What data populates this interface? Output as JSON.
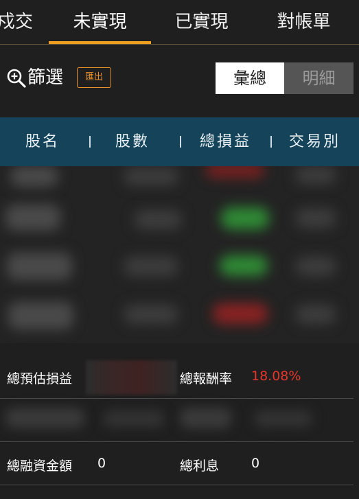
{
  "tabs": [
    {
      "label": "成交",
      "visible_text": "戍交"
    },
    {
      "label": "未實現"
    },
    {
      "label": "已實現"
    },
    {
      "label": "對帳單"
    }
  ],
  "active_tab": "未實現",
  "filter": {
    "label": "篩選",
    "export_label": "匯出",
    "view_toggle": {
      "summary": "彙總",
      "detail": "明細",
      "selected": "彙總"
    }
  },
  "table_header": {
    "name": "股名",
    "shares": "股數",
    "total_pl": "總損益",
    "trade_type": "交易別"
  },
  "summary": {
    "est_pl_label": "總預估損益",
    "return_rate_label": "總報酬率",
    "return_rate_value": "18.08%",
    "margin_amount_label": "總融資金額",
    "margin_amount_value": "0",
    "interest_label": "總利息",
    "interest_value": "0"
  },
  "colors": {
    "accent": "#f0a020",
    "header_bg": "#14435a",
    "loss_red": "#e8352c",
    "gain_green": "#3fae4a"
  }
}
